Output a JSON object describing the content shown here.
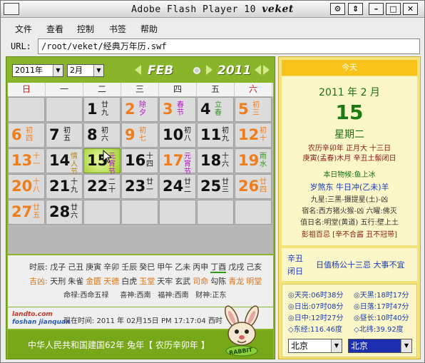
{
  "window": {
    "title": "Adobe Flash Player 10",
    "title_brand": "veket"
  },
  "titlebar_buttons": [
    "⚙",
    "⇕",
    "–",
    "□",
    "✕"
  ],
  "menu": [
    "文件",
    "查看",
    "控制",
    "书签",
    "帮助"
  ],
  "url": {
    "label": "URL:",
    "value": "/root/veket/经典万年历.swf"
  },
  "calendar": {
    "year_select": "2011年",
    "month_select": "2月",
    "month_banner": "FEB",
    "year_banner": "2011",
    "weekdays": [
      "日",
      "一",
      "二",
      "三",
      "四",
      "五",
      "六"
    ],
    "weeks": [
      [
        null,
        null,
        {
          "d": "1",
          "l": "廿九",
          "dc": "#111",
          "lc": "#111"
        },
        {
          "d": "2",
          "l": "除夕",
          "dc": "#f07d1c",
          "lc": "#b512c8"
        },
        {
          "d": "3",
          "l": "春节",
          "dc": "#f07d1c",
          "lc": "#b512c8"
        },
        {
          "d": "4",
          "l": "立春",
          "dc": "#111",
          "lc": "#2e9a1a"
        },
        {
          "d": "5",
          "l": "初三",
          "dc": "#f07d1c",
          "lc": "#f07d1c"
        }
      ],
      [
        {
          "d": "6",
          "l": "初四",
          "dc": "#f07d1c",
          "lc": "#f07d1c"
        },
        {
          "d": "7",
          "l": "初五",
          "dc": "#111",
          "lc": "#111"
        },
        {
          "d": "8",
          "l": "初六",
          "dc": "#111",
          "lc": "#111"
        },
        {
          "d": "9",
          "l": "初七",
          "dc": "#f07d1c",
          "lc": "#f07d1c"
        },
        {
          "d": "10",
          "l": "初八",
          "dc": "#111",
          "lc": "#111"
        },
        {
          "d": "11",
          "l": "初九",
          "dc": "#111",
          "lc": "#111"
        },
        {
          "d": "12",
          "l": "初十",
          "dc": "#f07d1c",
          "lc": "#f07d1c"
        }
      ],
      [
        {
          "d": "13",
          "l": "十一",
          "dc": "#f07d1c",
          "lc": "#f07d1c"
        },
        {
          "d": "14",
          "l": "情人节",
          "dc": "#111",
          "lc": "#b58a12"
        },
        {
          "d": "15",
          "l": "元宵节",
          "dc": "#111",
          "lc": "#b512c8",
          "today": true
        },
        {
          "d": "16",
          "l": "十四",
          "dc": "#111",
          "lc": "#111"
        },
        {
          "d": "17",
          "l": "元宵节",
          "dc": "#f07d1c",
          "lc": "#b512c8"
        },
        {
          "d": "18",
          "l": "十六",
          "dc": "#111",
          "lc": "#111"
        },
        {
          "d": "19",
          "l": "雨水",
          "dc": "#f07d1c",
          "lc": "#2e9a1a"
        }
      ],
      [
        {
          "d": "20",
          "l": "十八",
          "dc": "#f07d1c",
          "lc": "#f07d1c"
        },
        {
          "d": "21",
          "l": "十九",
          "dc": "#111",
          "lc": "#111"
        },
        {
          "d": "22",
          "l": "二十",
          "dc": "#111",
          "lc": "#111"
        },
        {
          "d": "23",
          "l": "廿一",
          "dc": "#111",
          "lc": "#111"
        },
        {
          "d": "24",
          "l": "廿二",
          "dc": "#111",
          "lc": "#111"
        },
        {
          "d": "25",
          "l": "廿三",
          "dc": "#111",
          "lc": "#111"
        },
        {
          "d": "26",
          "l": "廿四",
          "dc": "#f07d1c",
          "lc": "#f07d1c"
        }
      ],
      [
        {
          "d": "27",
          "l": "廿五",
          "dc": "#f07d1c",
          "lc": "#f07d1c"
        },
        {
          "d": "28",
          "l": "廿六",
          "dc": "#111",
          "lc": "#111"
        },
        null,
        null,
        null,
        null,
        null
      ]
    ],
    "shichen_label": "时辰:",
    "shichen": [
      "戊子",
      "己丑",
      "庚寅",
      "辛卯",
      "壬辰",
      "癸巳",
      "甲午",
      "乙未",
      "丙申",
      "丁酉",
      "戊戌",
      "己亥"
    ],
    "xiongji_label": "吉凶:",
    "xiongji": [
      {
        "t": "天刑",
        "c": "#333"
      },
      {
        "t": "朱雀",
        "c": "#333"
      },
      {
        "t": "金匮",
        "c": "#e07010"
      },
      {
        "t": "天德",
        "c": "#e07010"
      },
      {
        "t": "白虎",
        "c": "#333"
      },
      {
        "t": "玉堂",
        "c": "#e07010"
      },
      {
        "t": "天牢",
        "c": "#333"
      },
      {
        "t": "玄武",
        "c": "#333"
      },
      {
        "t": "司命",
        "c": "#e07010"
      },
      {
        "t": "勾陈",
        "c": "#333"
      },
      {
        "t": "青龙",
        "c": "#e07010"
      },
      {
        "t": "明堂",
        "c": "#e07010"
      }
    ],
    "mingzhen": "命禄:西命五禄",
    "xishen": "喜神:西南",
    "fushen": "福神:西南",
    "caishen": "财神:正东",
    "logo_top": "landto.com",
    "logo_bottom": "foshan jianquan",
    "now_time": "现在时间: 2011 年 02月15日 PM 17:17:04 西时",
    "rabbit_label": "RABBIT",
    "footer": "中华人民共和国建国62年    兔年【 农历辛卯年 】"
  },
  "today": {
    "label": "今天",
    "ym": "2011 年   2 月",
    "day": "15",
    "week": "星期二",
    "lunar1": "农历辛卯年 正月大 十三日",
    "lunar2": "庚寅(孟春)木月 辛丑土鬃闭日",
    "animal": "本日物候:鱼上冰",
    "sha": "岁煞东 牛日冲(乙未)羊",
    "jiuxing": "九星:三黑-摄提星(土)-凶",
    "xiu": "宿名:西方猪火猴-凶 六曜:佛灭",
    "zhi": "值日名:明堂(黄道) 五行:壁上土",
    "pengzu": "彭祖百忌 [辛不合酱 丑不冠带]"
  },
  "duty": {
    "ganzhi": "辛丑",
    "biri": "闭日",
    "text": "日值杨公十三忌 大事不宜"
  },
  "sun": {
    "rows": [
      [
        "◎天亮:06时38分",
        "◎天黑:18时17分"
      ],
      [
        "◎日出:07时08分",
        "◎日落:17时47分"
      ],
      [
        "◎日中:12时27分",
        "◎昼长:10时40分"
      ],
      [
        "◇东经:116.46度",
        "◇北纬:39.92度"
      ]
    ],
    "city1": "北京",
    "city2": "北京"
  },
  "colors": {
    "green": "#8ab52a",
    "orange": "#f07d1c",
    "today_green": "#2e8a1a"
  }
}
